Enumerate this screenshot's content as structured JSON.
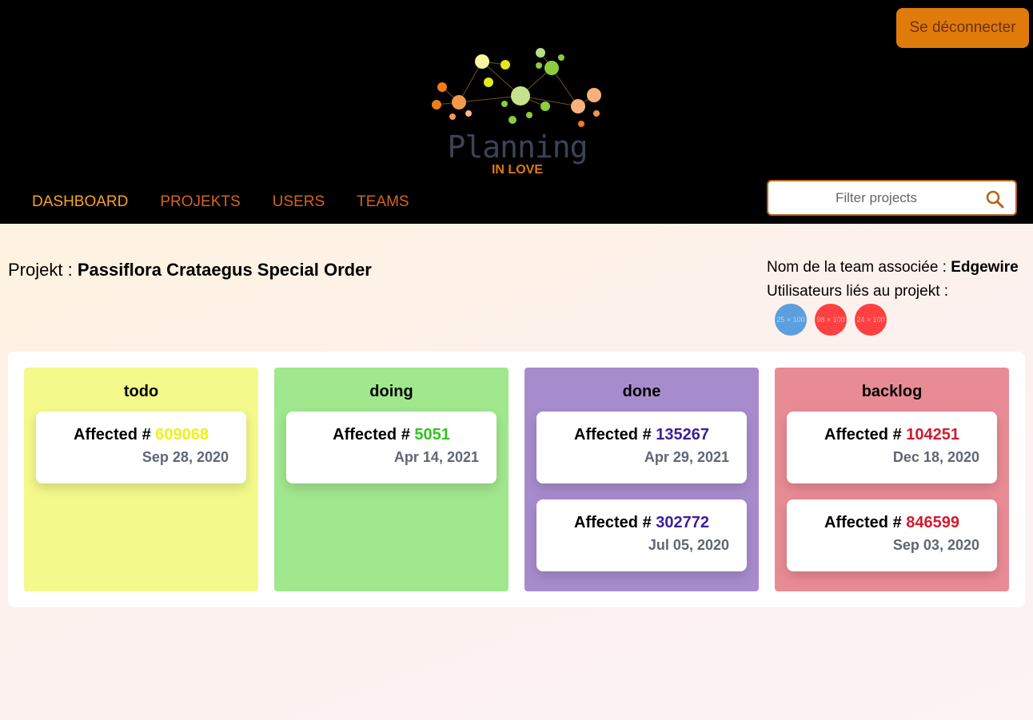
{
  "header": {
    "logout_label": "Se déconnecter",
    "logo_title": "Planning",
    "logo_subtitle": "IN LOVE",
    "nav": [
      {
        "label": "DASHBOARD",
        "active": true
      },
      {
        "label": "PROJEKTS",
        "active": false
      },
      {
        "label": "USERS",
        "active": false
      },
      {
        "label": "TEAMS",
        "active": false
      }
    ],
    "search_placeholder": "Filter projects",
    "search_icon": "search-icon"
  },
  "project": {
    "label": "Projekt : ",
    "name": "Passiflora Crataegus Special Order",
    "team_label": "Nom de la team associée : ",
    "team_name": "Edgewire",
    "users_label": "Utilisateurs liés au projekt :",
    "avatars": [
      {
        "text": "25 × 100",
        "color": "#5b9fdf"
      },
      {
        "text": "98 × 100",
        "color": "#ff4040"
      },
      {
        "text": "24 × 100",
        "color": "#ff4040"
      }
    ]
  },
  "board": {
    "columns": [
      {
        "title": "todo",
        "bg": "#f3f98a",
        "accent": "#f0f01a",
        "cards": [
          {
            "prefix": "Affected # ",
            "number": "609068",
            "date": "Sep 28, 2020"
          }
        ]
      },
      {
        "title": "doing",
        "bg": "#a1e78e",
        "accent": "#32c41f",
        "cards": [
          {
            "prefix": "Affected # ",
            "number": "5051",
            "date": "Apr 14, 2021"
          }
        ]
      },
      {
        "title": "done",
        "bg": "#a78ccd",
        "accent": "#3f1d99",
        "cards": [
          {
            "prefix": "Affected # ",
            "number": "135267",
            "date": "Apr 29, 2021"
          },
          {
            "prefix": "Affected # ",
            "number": "302772",
            "date": "Jul 05, 2020"
          }
        ]
      },
      {
        "title": "backlog",
        "bg": "#e98b94",
        "accent": "#d01c2e",
        "cards": [
          {
            "prefix": "Affected # ",
            "number": "104251",
            "date": "Dec 18, 2020"
          },
          {
            "prefix": "Affected # ",
            "number": "846599",
            "date": "Sep 03, 2020"
          }
        ]
      }
    ]
  }
}
